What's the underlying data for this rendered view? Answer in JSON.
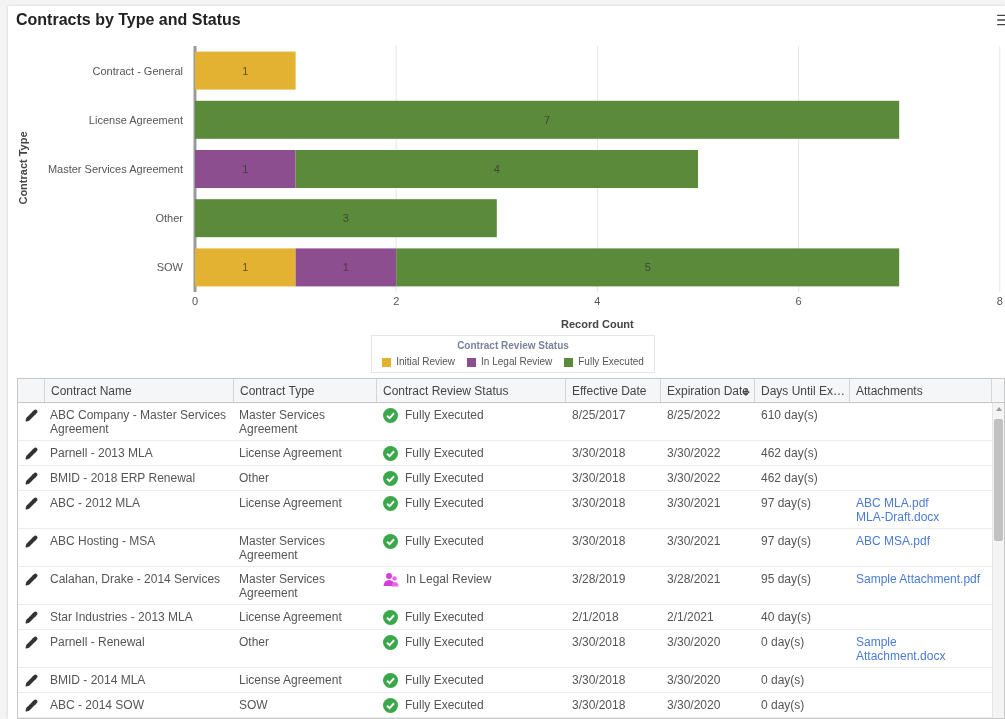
{
  "title": "Contracts by Type and Status",
  "chart_data": {
    "type": "bar",
    "orientation": "horizontal",
    "stacked": true,
    "ylabel": "Contract Type",
    "xlabel": "Record Count",
    "categories": [
      "Contract - General",
      "License Agreement",
      "Master Services Agreement",
      "Other",
      "SOW"
    ],
    "series": [
      {
        "name": "Initial Review",
        "color": "#e3b232",
        "values": [
          1,
          null,
          null,
          null,
          1
        ]
      },
      {
        "name": "In Legal Review",
        "color": "#8c4e8e",
        "values": [
          null,
          null,
          1,
          null,
          1
        ]
      },
      {
        "name": "Fully Executed",
        "color": "#5c8a3b",
        "values": [
          null,
          7,
          4,
          3,
          5
        ]
      }
    ],
    "xlim": [
      0,
      8
    ],
    "xticks": [
      0,
      2,
      4,
      6,
      8
    ],
    "data_labels": true,
    "grid": true,
    "legend_title": "Contract Review Status"
  },
  "table": {
    "columns": [
      {
        "label": "Contract Name",
        "sorted": false
      },
      {
        "label": "Contract Type",
        "sorted": false
      },
      {
        "label": "Contract Review Status",
        "sorted": false
      },
      {
        "label": "Effective Date",
        "sorted": false
      },
      {
        "label": "Expiration Date",
        "sorted": true
      },
      {
        "label": "Days Until Ex…",
        "sorted": false
      },
      {
        "label": "Attachments",
        "sorted": false
      }
    ],
    "rows": [
      {
        "name": "ABC Company - Master Services Agreement",
        "type": "Master Services Agreement",
        "status": "Fully Executed",
        "kind": "executed",
        "effective": "8/25/2017",
        "expiration": "8/25/2022",
        "days": "610 day(s)",
        "attachments": []
      },
      {
        "name": "Parnell - 2013 MLA",
        "type": "License Agreement",
        "status": "Fully Executed",
        "kind": "executed",
        "effective": "3/30/2018",
        "expiration": "3/30/2022",
        "days": "462 day(s)",
        "attachments": []
      },
      {
        "name": "BMID - 2018 ERP Renewal",
        "type": "Other",
        "status": "Fully Executed",
        "kind": "executed",
        "effective": "3/30/2018",
        "expiration": "3/30/2022",
        "days": "462 day(s)",
        "attachments": []
      },
      {
        "name": "ABC - 2012 MLA",
        "type": "License Agreement",
        "status": "Fully Executed",
        "kind": "executed",
        "effective": "3/30/2018",
        "expiration": "3/30/2021",
        "days": "97 day(s)",
        "attachments": [
          "ABC MLA.pdf",
          "MLA-Draft.docx"
        ]
      },
      {
        "name": "ABC Hosting - MSA",
        "type": "Master Services Agreement",
        "status": "Fully Executed",
        "kind": "executed",
        "effective": "3/30/2018",
        "expiration": "3/30/2021",
        "days": "97 day(s)",
        "attachments": [
          "ABC MSA.pdf"
        ]
      },
      {
        "name": "Calahan, Drake - 2014 Services",
        "type": "Master Services Agreement",
        "status": "In Legal Review",
        "kind": "legal",
        "effective": "3/28/2019",
        "expiration": "3/28/2021",
        "days": "95 day(s)",
        "attachments": [
          "Sample Attachment.pdf"
        ]
      },
      {
        "name": "Star Industries - 2013 MLA",
        "type": "License Agreement",
        "status": "Fully Executed",
        "kind": "executed",
        "effective": "2/1/2018",
        "expiration": "2/1/2021",
        "days": "40 day(s)",
        "attachments": []
      },
      {
        "name": "Parnell - Renewal",
        "type": "Other",
        "status": "Fully Executed",
        "kind": "executed",
        "effective": "3/30/2018",
        "expiration": "3/30/2020",
        "days": "0 day(s)",
        "attachments": [
          "Sample Attachment.docx"
        ]
      },
      {
        "name": "BMID - 2014 MLA",
        "type": "License Agreement",
        "status": "Fully Executed",
        "kind": "executed",
        "effective": "3/30/2018",
        "expiration": "3/30/2020",
        "days": "0 day(s)",
        "attachments": []
      },
      {
        "name": "ABC - 2014 SOW",
        "type": "SOW",
        "status": "Fully Executed",
        "kind": "executed",
        "effective": "3/30/2018",
        "expiration": "3/30/2020",
        "days": "0 day(s)",
        "attachments": []
      }
    ]
  }
}
